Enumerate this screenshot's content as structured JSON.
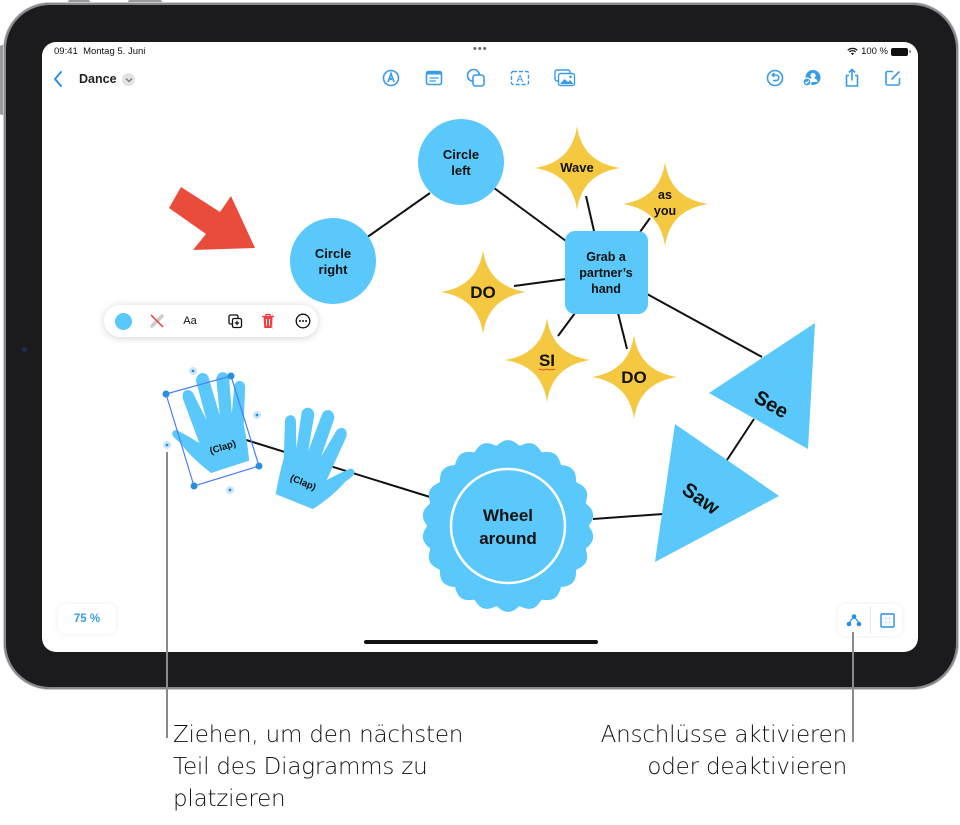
{
  "status_bar": {
    "time": "09:41",
    "date": "Montag 5. Juni",
    "multitask_dots": "•••",
    "battery_text": "100 %"
  },
  "toolbar": {
    "back_icon": "chevron-left-icon",
    "title": "Dance",
    "title_menu_icon": "chevron-down-icon",
    "center_tools": [
      {
        "name": "pen-tool",
        "icon": "pen-nib-icon"
      },
      {
        "name": "sticky-note",
        "icon": "note-icon"
      },
      {
        "name": "shapes",
        "icon": "shapes-icon"
      },
      {
        "name": "text-box",
        "icon": "text-box-icon"
      },
      {
        "name": "media",
        "icon": "photo-icon"
      }
    ],
    "right_tools": [
      {
        "name": "undo",
        "icon": "undo-circle-icon"
      },
      {
        "name": "collaborate",
        "icon": "collaborator-icon"
      },
      {
        "name": "share",
        "icon": "share-icon"
      },
      {
        "name": "new-board",
        "icon": "compose-icon"
      }
    ]
  },
  "context_menu": {
    "items": [
      {
        "name": "fill-color",
        "icon": "color-swatch-icon",
        "color": "#5ac8fa"
      },
      {
        "name": "stroke",
        "icon": "no-stroke-icon"
      },
      {
        "name": "text-style",
        "label": "Aa"
      },
      {
        "name": "duplicate",
        "icon": "duplicate-icon"
      },
      {
        "name": "delete",
        "icon": "trash-icon"
      },
      {
        "name": "more",
        "icon": "ellipsis-circle-icon"
      }
    ]
  },
  "board": {
    "colors": {
      "blue": "#5ac8fa",
      "yellow": "#f5c842",
      "red": "#ea4c3c",
      "selection": "#4c7ef0"
    },
    "shapes": [
      {
        "id": "circle-left",
        "type": "circle",
        "lines": [
          "Circle",
          "left"
        ]
      },
      {
        "id": "circle-right",
        "type": "circle",
        "lines": [
          "Circle",
          "right"
        ]
      },
      {
        "id": "grab",
        "type": "rounded-square",
        "lines": [
          "Grab a",
          "partner’s",
          "hand"
        ]
      },
      {
        "id": "wave",
        "type": "star",
        "lines": [
          "Wave"
        ]
      },
      {
        "id": "as-you",
        "type": "star",
        "lines": [
          "as",
          "you"
        ]
      },
      {
        "id": "do-1",
        "type": "star",
        "lines": [
          "DO"
        ]
      },
      {
        "id": "si",
        "type": "star",
        "lines": [
          "SI"
        ]
      },
      {
        "id": "do-2",
        "type": "star",
        "lines": [
          "DO"
        ]
      },
      {
        "id": "see",
        "type": "triangle",
        "lines": [
          "See"
        ]
      },
      {
        "id": "saw",
        "type": "triangle",
        "lines": [
          "Saw"
        ]
      },
      {
        "id": "wheel",
        "type": "scalloped-circle",
        "lines": [
          "Wheel",
          "around"
        ]
      },
      {
        "id": "clap-1",
        "type": "hand",
        "lines": [
          "(Clap)"
        ],
        "selected": true
      },
      {
        "id": "clap-2",
        "type": "hand",
        "lines": [
          "(Clap)"
        ]
      },
      {
        "id": "arrow",
        "type": "arrow",
        "lines": []
      }
    ],
    "connections": [
      [
        "circle-right",
        "circle-left"
      ],
      [
        "circle-left",
        "grab"
      ],
      [
        "wave",
        "grab"
      ],
      [
        "as-you",
        "grab"
      ],
      [
        "do-1",
        "grab"
      ],
      [
        "si",
        "grab"
      ],
      [
        "do-2",
        "grab"
      ],
      [
        "grab",
        "see"
      ],
      [
        "see",
        "saw"
      ],
      [
        "saw",
        "wheel"
      ],
      [
        "wheel",
        "clap-1"
      ]
    ]
  },
  "zoom_level": "75 %",
  "bottom_controls": [
    {
      "name": "connections-toggle",
      "icon": "connection-nodes-icon"
    },
    {
      "name": "grid-toggle",
      "icon": "grid-icon"
    }
  ],
  "callouts": {
    "left": [
      "Ziehen, um den nächsten",
      "Teil des Diagramms zu",
      "platzieren"
    ],
    "right": [
      "Anschlüsse aktivieren",
      "oder deaktivieren"
    ]
  }
}
